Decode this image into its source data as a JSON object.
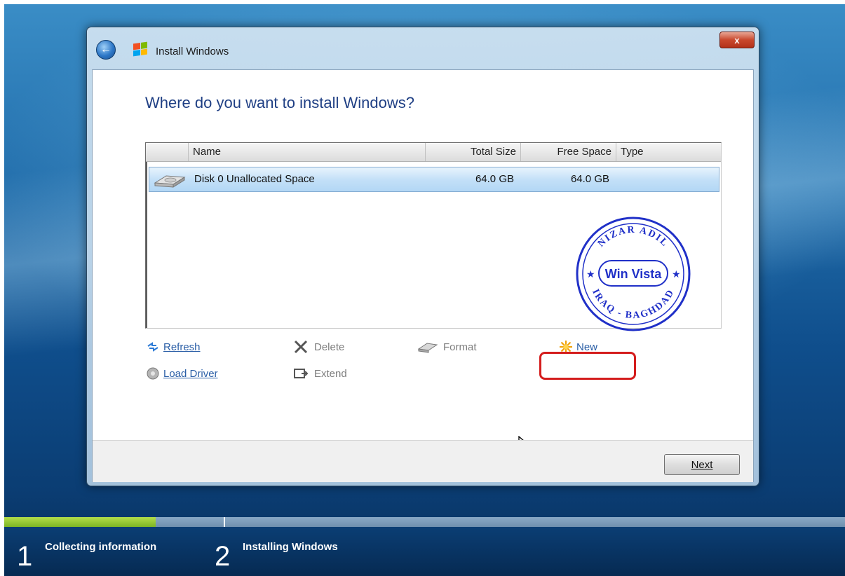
{
  "window": {
    "title": "Install Windows",
    "close_label": "x",
    "heading": "Where do you want to install Windows?"
  },
  "disk_list": {
    "columns": [
      "Name",
      "Total Size",
      "Free Space",
      "Type"
    ],
    "rows": [
      {
        "name": "Disk 0 Unallocated Space",
        "total_size": "64.0 GB",
        "free_space": "64.0 GB",
        "type": ""
      }
    ]
  },
  "stamp": {
    "center_text": "Win Vista",
    "top_text": "NIZAR ADIL",
    "bottom_text": "IRAQ - BAGHDAD"
  },
  "actions": {
    "refresh": {
      "label": "Refresh",
      "icon": "refresh-icon"
    },
    "delete": {
      "label": "Delete",
      "icon": "delete-icon"
    },
    "format": {
      "label": "Format",
      "icon": "format-icon"
    },
    "new": {
      "label": "New",
      "icon": "new-icon"
    },
    "load_driver": {
      "label": "Load Driver",
      "icon": "load-driver-icon"
    },
    "extend": {
      "label": "Extend",
      "icon": "extend-icon"
    }
  },
  "footer": {
    "next_label": "Next"
  },
  "progress": {
    "fraction": 0.18,
    "steps": [
      {
        "number": "1",
        "label": "Collecting information"
      },
      {
        "number": "2",
        "label": "Installing Windows"
      }
    ]
  },
  "colors": {
    "heading": "#1f3f84",
    "link": "#2a5ea6",
    "highlight": "#d41d1d",
    "progress_fill": "#7cb524"
  }
}
